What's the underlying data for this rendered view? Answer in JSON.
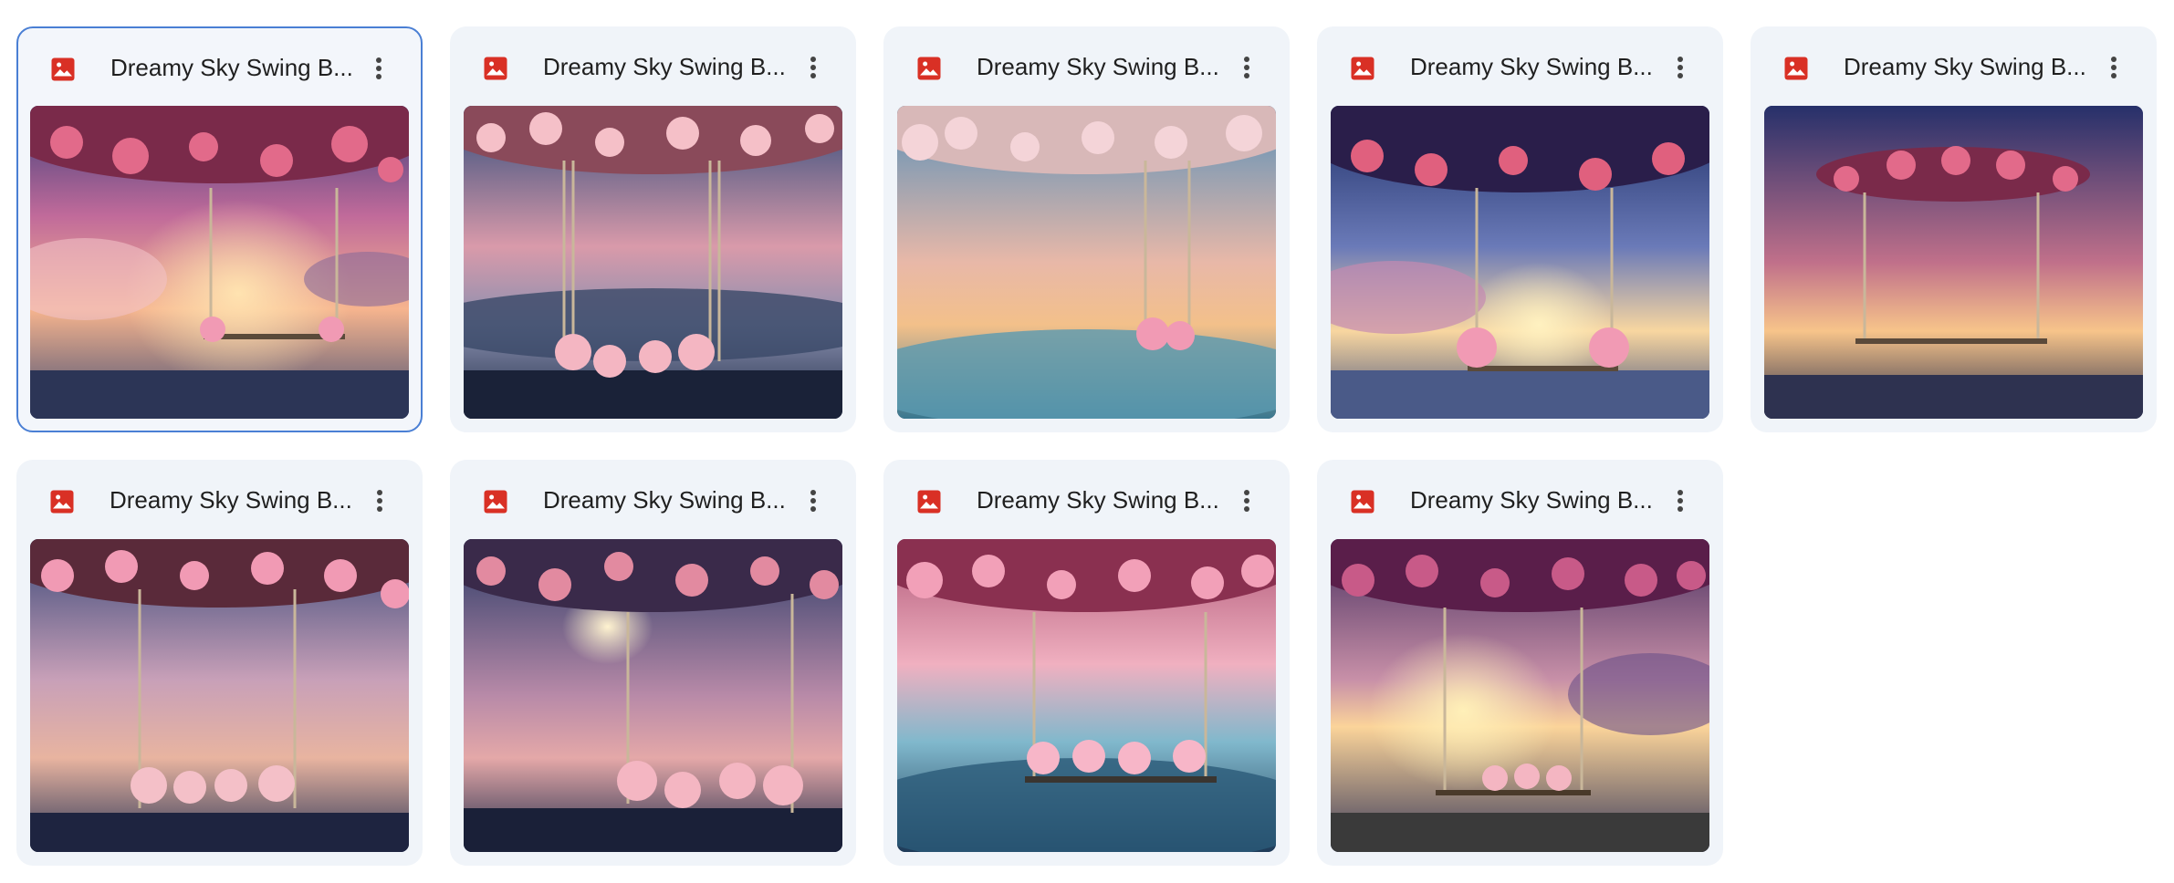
{
  "files": [
    {
      "name": "Dreamy Sky Swing B...",
      "icon": "image-file-icon",
      "selected": true
    },
    {
      "name": "Dreamy Sky Swing B...",
      "icon": "image-file-icon",
      "selected": false
    },
    {
      "name": "Dreamy Sky Swing B...",
      "icon": "image-file-icon",
      "selected": false
    },
    {
      "name": "Dreamy Sky Swing B...",
      "icon": "image-file-icon",
      "selected": false
    },
    {
      "name": "Dreamy Sky Swing B...",
      "icon": "image-file-icon",
      "selected": false
    },
    {
      "name": "Dreamy Sky Swing B...",
      "icon": "image-file-icon",
      "selected": false
    },
    {
      "name": "Dreamy Sky Swing B...",
      "icon": "image-file-icon",
      "selected": false
    },
    {
      "name": "Dreamy Sky Swing B...",
      "icon": "image-file-icon",
      "selected": false
    },
    {
      "name": "Dreamy Sky Swing B...",
      "icon": "image-file-icon",
      "selected": false
    }
  ],
  "colors": {
    "card_bg": "#f0f4f9",
    "selected_border": "#4a7fd4",
    "image_icon": "#d93025",
    "title_text": "#1f1f1f"
  }
}
